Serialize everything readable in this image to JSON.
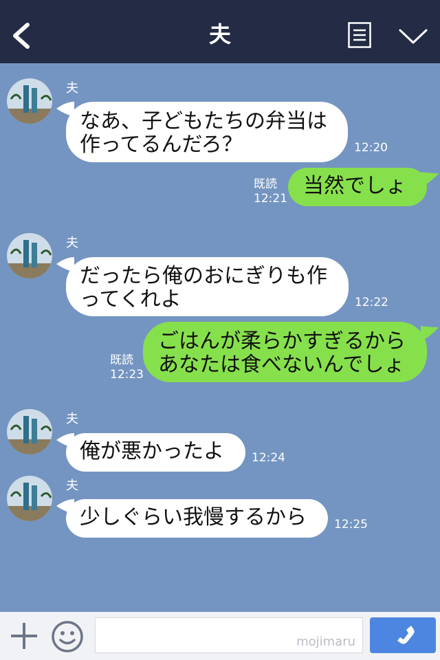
{
  "header": {
    "title": "夫",
    "back_icon": "chevron-left-icon",
    "notes_icon": "notes-icon",
    "menu_icon": "chevron-down-icon"
  },
  "messages": [
    {
      "sender": "夫",
      "text": "なあ、子どもたちの弁当は\n作ってるんだろ？",
      "time": "12:20"
    },
    {
      "read": "既読",
      "text": "当然でしょ",
      "time": "12:21"
    },
    {
      "sender": "夫",
      "text": "だったら俺のおにぎりも作\nってくれよ",
      "time": "12:22"
    },
    {
      "read": "既読",
      "text": "ごはんが柔らかすぎるから\nあなたは食べないんでしょ",
      "time": "12:23"
    },
    {
      "sender": "夫",
      "text": "俺が悪かったよ",
      "time": "12:24"
    },
    {
      "sender": "夫",
      "text": "少しぐらい我慢するから",
      "time": "12:25"
    }
  ],
  "footer": {
    "plus_icon": "plus-icon",
    "emoji_icon": "emoji-icon",
    "input_value": "",
    "watermark": "mojimaru",
    "call_icon": "phone-icon"
  },
  "colors": {
    "header": "#232c44",
    "background": "#7495c1",
    "bubble_in": "#ffffff",
    "bubble_out": "#86e04c",
    "call_button": "#4d86e0"
  }
}
